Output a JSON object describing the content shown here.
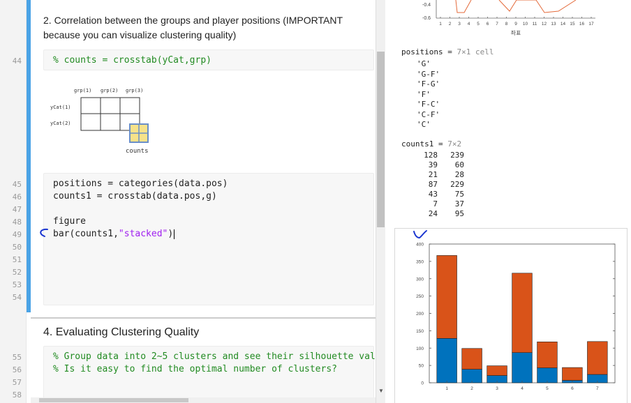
{
  "editor": {
    "section2_heading_line1": "2. Correlation between the groups and player positions (IMPORTANT",
    "section2_heading_line2": "because you can visualize clustering quality)",
    "line44_code": "% counts = crosstab(yCat,grp)",
    "diagram": {
      "col_headers": [
        "grp(1)",
        "grp(2)",
        "grp(3)"
      ],
      "row_headers": [
        "yCat(1)",
        "yCat(2)"
      ],
      "label": "counts"
    },
    "line45_code": "positions = categories(data.pos)",
    "line46_code": "counts1 = crosstab(data.pos,g)",
    "line48_code": "figure",
    "line49_code_prefix": "bar(counts1,",
    "line49_code_string": "\"stacked\"",
    "line49_code_suffix": ")",
    "section4_heading": "4. Evaluating Clustering Quality",
    "line55_comment": "% Group data into 2~5 clusters and see their silhouette valu",
    "line56_comment": "% Is it easy to find the optimal number of clusters?",
    "line_numbers": [
      "44",
      "45",
      "46",
      "47",
      "48",
      "49",
      "50",
      "51",
      "52",
      "53",
      "54",
      "55",
      "56",
      "57",
      "58"
    ]
  },
  "output": {
    "top_plot": {
      "yticks": [
        "-0.4",
        "-0.6"
      ],
      "xticks": [
        "1",
        "2",
        "3",
        "4",
        "5",
        "6",
        "7",
        "8",
        "9",
        "10",
        "11",
        "12",
        "13",
        "14",
        "15",
        "16",
        "17"
      ],
      "xlabel": "좌표",
      "line_color": "#e46a3a"
    },
    "positions_label": "positions = ",
    "positions_size": "7×1 cell",
    "positions_values": [
      "'G'",
      "'G-F'",
      "'F-G'",
      "'F'",
      "'F-C'",
      "'C-F'",
      "'C'"
    ],
    "counts1_label": "counts1 = ",
    "counts1_size": "7×2",
    "counts1_rows": [
      [
        "128",
        "239"
      ],
      [
        "39",
        "60"
      ],
      [
        "21",
        "28"
      ],
      [
        "87",
        "229"
      ],
      [
        "43",
        "75"
      ],
      [
        "7",
        "37"
      ],
      [
        "24",
        "95"
      ]
    ]
  },
  "chart_data": {
    "type": "bar",
    "stacked": true,
    "categories": [
      "1",
      "2",
      "3",
      "4",
      "5",
      "6",
      "7"
    ],
    "series": [
      {
        "values": [
          128,
          39,
          21,
          87,
          43,
          7,
          24
        ],
        "color": "#0072bd"
      },
      {
        "values": [
          239,
          60,
          28,
          229,
          75,
          37,
          95
        ],
        "color": "#d95319"
      }
    ],
    "ylim": [
      0,
      400
    ],
    "yticks": [
      "0",
      "50",
      "100",
      "150",
      "200",
      "250",
      "300",
      "350",
      "400"
    ],
    "grid": false,
    "xlabel": "",
    "ylabel": "",
    "title": ""
  }
}
